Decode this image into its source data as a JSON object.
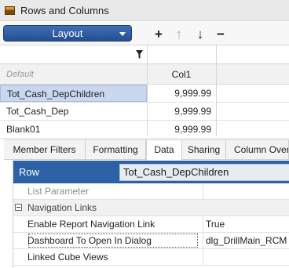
{
  "window": {
    "title": "Rows and Columns"
  },
  "toolbar": {
    "layout_label": "Layout",
    "icons": [
      "plus-icon",
      "arrow-up-icon",
      "arrow-down-icon",
      "minus-icon"
    ]
  },
  "grid": {
    "default_label": "Default",
    "column_header": "Col1",
    "rows": [
      {
        "label": "Tot_Cash_DepChildren",
        "value": "9,999.99"
      },
      {
        "label": "Tot_Cash_Dep",
        "value": "9,999.99"
      },
      {
        "label": "Blank01",
        "value": "9,999.99"
      }
    ]
  },
  "tabs": [
    "Member Filters",
    "Formatting",
    "Data",
    "Sharing",
    "Column Over"
  ],
  "active_tab": "Data",
  "properties": {
    "header_label": "Row",
    "header_value": "Tot_Cash_DepChildren",
    "list_parameter_label": "List Parameter",
    "section_label": "Navigation Links",
    "items": [
      {
        "label": "Enable Report Navigation Link",
        "value": "True"
      },
      {
        "label": "Dashboard To Open In Dialog",
        "value": "dlg_DrillMain_RCM"
      },
      {
        "label": "Linked Cube Views",
        "value": ""
      }
    ]
  },
  "colors": {
    "accent": "#2d61a6",
    "selection": "#c9d8ee",
    "header_bg": "#f1f1f1"
  }
}
